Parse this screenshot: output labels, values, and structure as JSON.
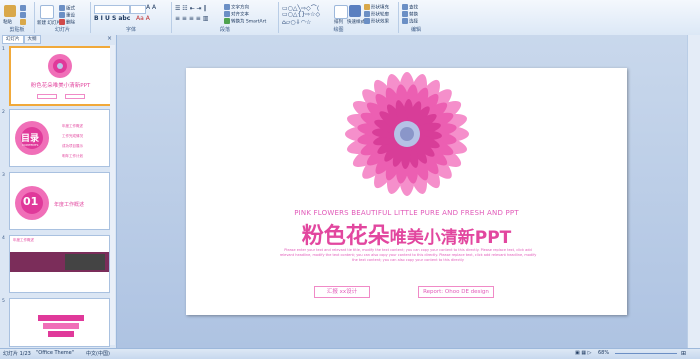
{
  "ribbon": {
    "groups": [
      "剪贴板",
      "幻灯片",
      "字体",
      "段落",
      "绘图",
      "编辑"
    ],
    "paste": "粘贴",
    "new_slide": "新建\n幻灯片",
    "layout": "版式",
    "reset": "重设",
    "delete": "删除",
    "text_direction": "文字方向",
    "align_text": "对齐文本",
    "convert_smartart": "转换为 SmartArt",
    "arrange": "排列",
    "quick_styles": "快速样式",
    "shape_fill": "形状填充",
    "shape_outline": "形状轮廓",
    "shape_effects": "形状效果",
    "find": "查找",
    "replace": "替换",
    "select": "选择"
  },
  "panel": {
    "tab_slides": "幻灯片",
    "tab_outline": "大纲",
    "close": "×",
    "numbers": [
      "1",
      "2",
      "3",
      "4",
      "5"
    ],
    "thumb1_title": "粉色花朵唯美小清新PPT",
    "thumb2_title": "目录",
    "thumb2_sub": "CONTENTS",
    "thumb2_items": [
      "年度工作概述",
      "工作完成情况",
      "成功项目展示",
      "明年工作计划"
    ],
    "thumb3_num": "01",
    "thumb3_text": "年度工作概述",
    "thumb4_title": "年度工作概述"
  },
  "slide": {
    "subtitle_en": "PINK FLOWERS BEAUTIFUL LITTLE PURE AND FRESH AND PPT",
    "title_main": "粉色花朵",
    "title_rest": "唯美小清新PPT",
    "lorem": "Please enter your text and relevant tie title, modify the text content; you can copy your content to this directly. Please replace text, click add relevant headline, modify the text content; you can also copy your content to this directly. Please replace text, click add relevant headline, modify the text content; you can also copy your content to this directly",
    "pill_left": "汇报 xx设计",
    "pill_right": "Report: Ohoo DE design"
  },
  "status": {
    "slide_pos": "幻灯片 1/23",
    "theme": "\"Office Theme\"",
    "language": "中文(中国)",
    "zoom": "68%"
  },
  "colors": {
    "accent": "#e2479f",
    "ribbon": "#dce8f6",
    "canvas": "#b3c7e4"
  }
}
